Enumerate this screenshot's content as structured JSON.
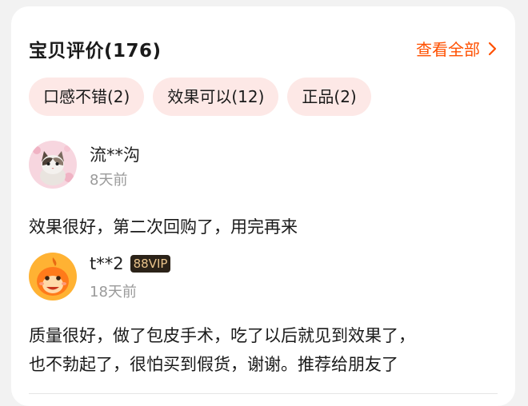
{
  "section": {
    "title": "宝贝评价(176)",
    "view_all_label": "查看全部"
  },
  "tags": [
    {
      "label": "口感不错(2)"
    },
    {
      "label": "效果可以(12)"
    },
    {
      "label": "正品(2)"
    }
  ],
  "reviews": [
    {
      "username": "流**沟",
      "time": "8天前",
      "content": "效果很好，第二次回购了，用完再来"
    },
    {
      "username": "t**2",
      "badge": "88VIP",
      "time": "18天前",
      "content_lines": [
        "质量很好，做了包皮手术，吃了以后就见到效果了，",
        "也不勃起了，很怕买到假货，谢谢。推荐给朋友了"
      ]
    }
  ],
  "colors": {
    "accent": "#ff5000",
    "tag_bg": "#fde8e6",
    "vip_bg": "#2b2218",
    "vip_text": "#e9c38b"
  }
}
